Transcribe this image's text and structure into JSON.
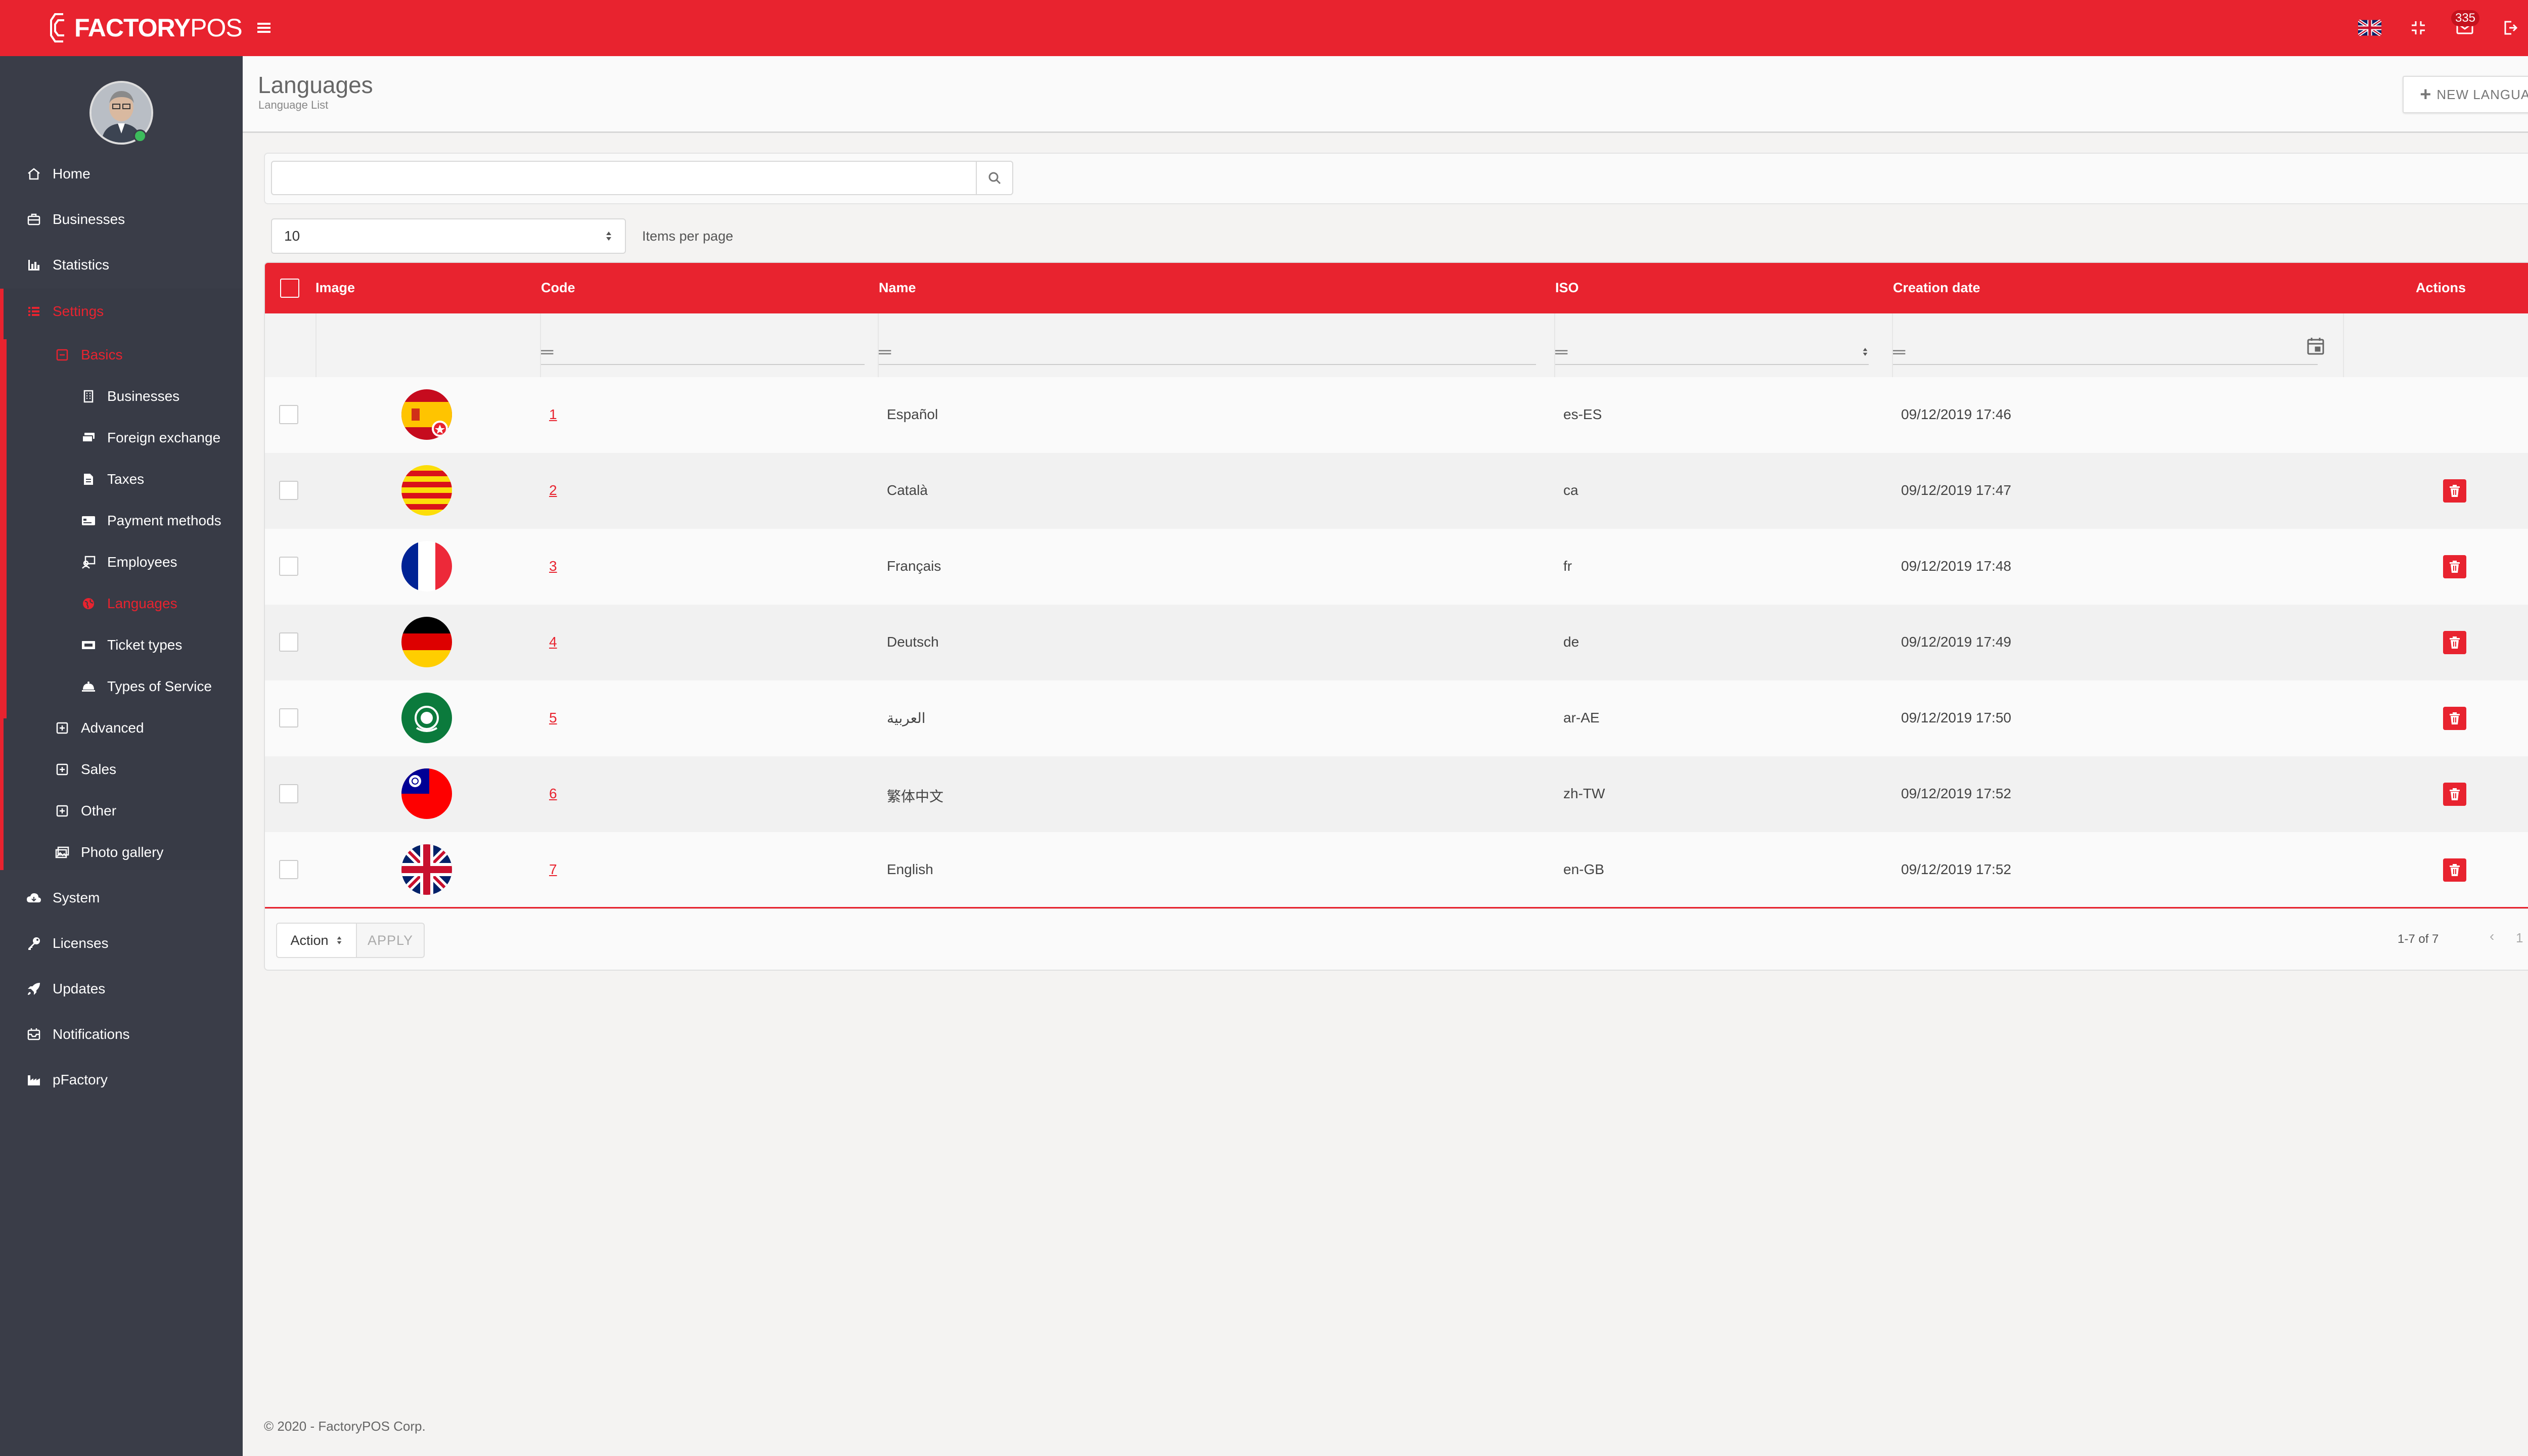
{
  "app": {
    "logo_bold": "FACTORY",
    "logo_light": "POS"
  },
  "topbar": {
    "notification_count": "335"
  },
  "sidebar": {
    "items": [
      {
        "label": "Home",
        "icon": "home-icon"
      },
      {
        "label": "Businesses",
        "icon": "briefcase-icon"
      },
      {
        "label": "Statistics",
        "icon": "bar-chart-icon"
      },
      {
        "label": "Settings",
        "icon": "list-icon"
      },
      {
        "label": "Basics",
        "icon": "minus-square-icon"
      },
      {
        "label": "Businesses",
        "icon": "building-icon"
      },
      {
        "label": "Foreign exchange",
        "icon": "money-icon"
      },
      {
        "label": "Taxes",
        "icon": "document-icon"
      },
      {
        "label": "Payment methods",
        "icon": "credit-card-icon"
      },
      {
        "label": "Employees",
        "icon": "employee-icon"
      },
      {
        "label": "Languages",
        "icon": "globe-icon"
      },
      {
        "label": "Ticket types",
        "icon": "ticket-icon"
      },
      {
        "label": "Types of Service",
        "icon": "service-icon"
      },
      {
        "label": "Advanced",
        "icon": "plus-square-icon"
      },
      {
        "label": "Sales",
        "icon": "plus-square-icon"
      },
      {
        "label": "Other",
        "icon": "plus-square-icon"
      },
      {
        "label": "Photo gallery",
        "icon": "images-icon"
      },
      {
        "label": "System",
        "icon": "cloud-icon"
      },
      {
        "label": "Licenses",
        "icon": "key-icon"
      },
      {
        "label": "Updates",
        "icon": "rocket-icon"
      },
      {
        "label": "Notifications",
        "icon": "bell-box-icon"
      },
      {
        "label": "pFactory",
        "icon": "factory-icon"
      }
    ]
  },
  "header": {
    "title": "Languages",
    "subtitle": "Language List",
    "new_button": "NEW LANGUAGE"
  },
  "search": {
    "value": "",
    "placeholder": ""
  },
  "paging": {
    "per_page": "10",
    "per_page_label": "Items per page",
    "info": "1-7 of 7",
    "current_page": "1"
  },
  "table": {
    "columns": [
      "Image",
      "Code",
      "Name",
      "ISO",
      "Creation date",
      "Actions"
    ],
    "rows": [
      {
        "code": "1",
        "name": "Español",
        "iso": "es-ES",
        "date": "09/12/2019 17:46",
        "flag": "spain",
        "deletable": false
      },
      {
        "code": "2",
        "name": "Català",
        "iso": "ca",
        "date": "09/12/2019 17:47",
        "flag": "catalonia",
        "deletable": true
      },
      {
        "code": "3",
        "name": "Français",
        "iso": "fr",
        "date": "09/12/2019 17:48",
        "flag": "france",
        "deletable": true
      },
      {
        "code": "4",
        "name": "Deutsch",
        "iso": "de",
        "date": "09/12/2019 17:49",
        "flag": "germany",
        "deletable": true
      },
      {
        "code": "5",
        "name": "العربية",
        "iso": "ar-AE",
        "date": "09/12/2019 17:50",
        "flag": "arab-league",
        "deletable": true
      },
      {
        "code": "6",
        "name": "繁体中文",
        "iso": "zh-TW",
        "date": "09/12/2019 17:52",
        "flag": "taiwan",
        "deletable": true
      },
      {
        "code": "7",
        "name": "English",
        "iso": "en-GB",
        "date": "09/12/2019 17:52",
        "flag": "uk",
        "deletable": true
      }
    ]
  },
  "bulk": {
    "action_label": "Action",
    "apply_label": "APPLY"
  },
  "footer": {
    "copyright": "© 2020 - FactoryPOS Corp."
  },
  "colors": {
    "brand_red": "#e8232f",
    "sidebar_bg": "#3a3d48",
    "page_bg": "#f4f3f2",
    "chat_blue": "#2a7fc1"
  }
}
